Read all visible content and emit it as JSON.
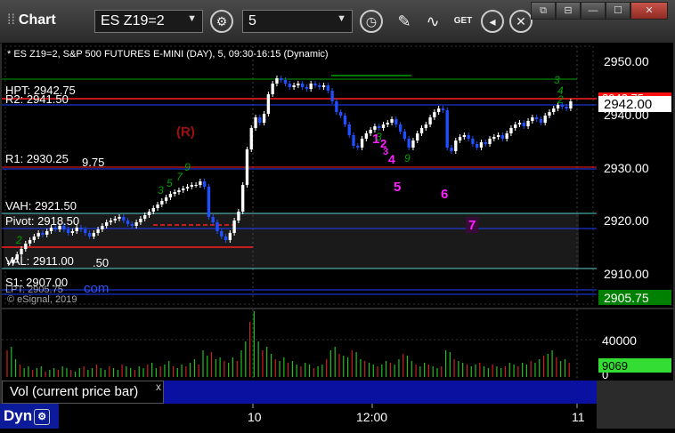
{
  "toolbar": {
    "title": "Chart",
    "symbol": "ES Z19=2",
    "interval": "5",
    "get_label": "GET"
  },
  "chart": {
    "header": "* ES Z19=2, S&P 500 FUTURES E-MINI (DAY), 5, 09:30-16:15 (Dynamic)",
    "watermark": "© eSignal, 2019",
    "com_text": "com",
    "levels": [
      {
        "label": "HPT: 2942.75",
        "color": "#ff3030"
      },
      {
        "label": "R2: 2941.50",
        "color": "#ffffff"
      },
      {
        "label": "R1: 2930.25",
        "color": "#ffffff"
      },
      {
        "label": "9.75",
        "color": "#ffffff"
      },
      {
        "label": "VAH: 2921.50",
        "color": "#ffffff"
      },
      {
        "label": "Pivot: 2918.50",
        "color": "#ffffff"
      },
      {
        "label": "VAL: 2911.00",
        "color": "#ffffff"
      },
      {
        "label": ".50",
        "color": "#ffffff"
      },
      {
        "label": "S1: 2907.00",
        "color": "#ffffff"
      },
      {
        "label": "LPT: 2905.75",
        "color": "#ffffff"
      }
    ],
    "annotations": {
      "r": "(R)",
      "n1": "1",
      "n2": "2",
      "n3": "3",
      "n4": "4",
      "n5": "5",
      "n6": "6",
      "n7": "7"
    },
    "price_ticks": [
      "2950.00",
      "2940.00",
      "2930.00",
      "2920.00",
      "2910.00"
    ],
    "flags": {
      "hpt": "2942.75",
      "last": "2942.00",
      "lpt": "2905.75"
    },
    "colors": {
      "up": "#ffffff",
      "down": "#1f4fff",
      "hpt": "#ff2020",
      "green": "#00a000",
      "magenta": "#ff20ff"
    }
  },
  "volume": {
    "label": "Vol (current price bar)",
    "close_icon": "x",
    "ticks": [
      "40000",
      "0"
    ],
    "flag": "9069"
  },
  "time_axis": {
    "ticks": [
      "10",
      "12:00",
      "11"
    ],
    "dyn": "Dyn"
  }
}
